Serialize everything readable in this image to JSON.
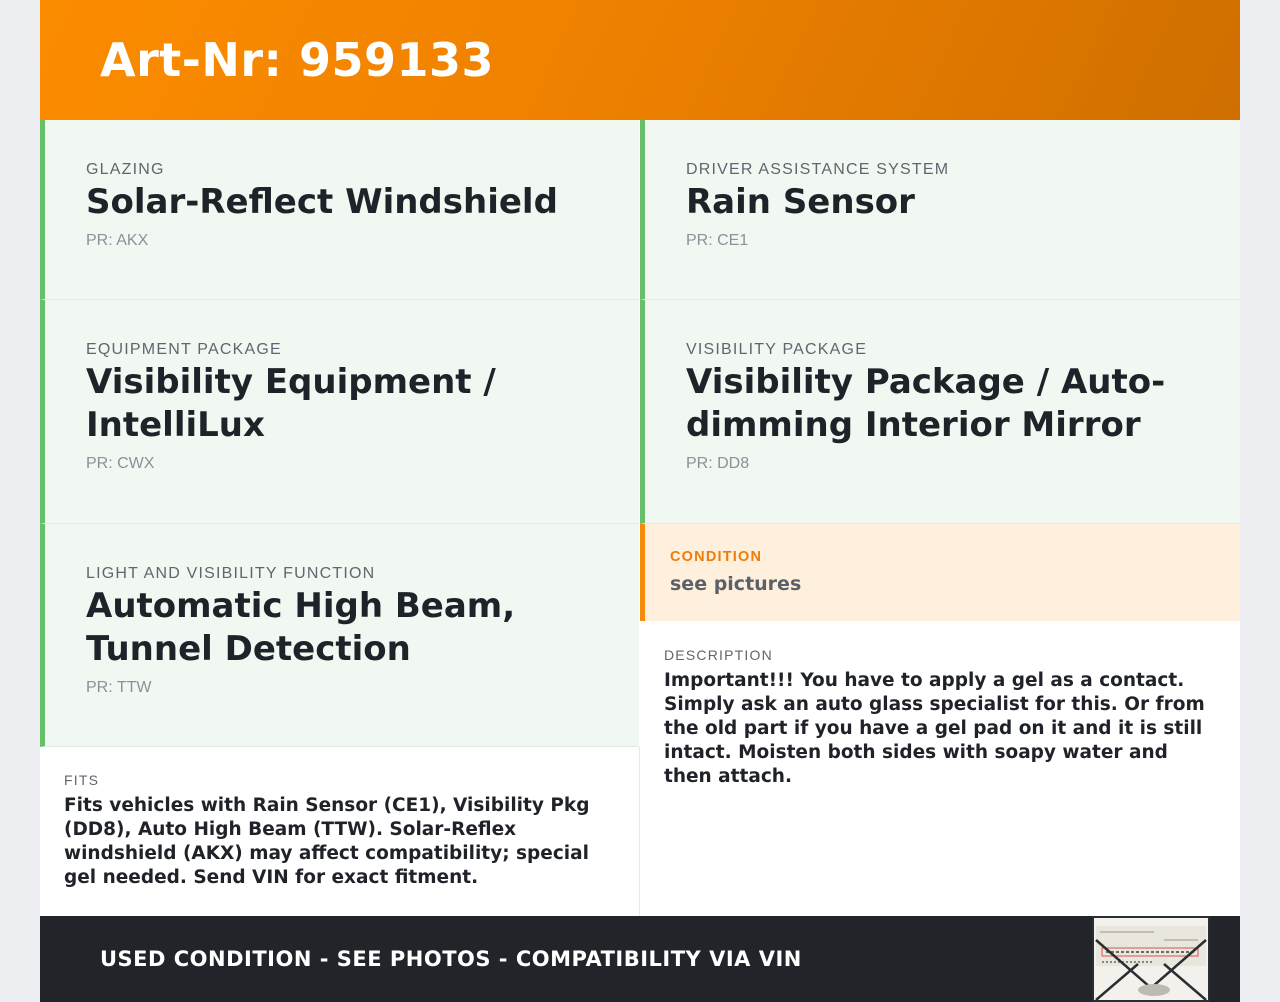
{
  "header": {
    "title": "Art-Nr: 959133"
  },
  "features": [
    {
      "category": "GLAZING",
      "name": "Solar-Reflect Windshield",
      "pr": "PR: AKX"
    },
    {
      "category": "DRIVER ASSISTANCE SYSTEM",
      "name": "Rain Sensor",
      "pr": "PR: CE1"
    },
    {
      "category": "EQUIPMENT PACKAGE",
      "name": "Visibility Equipment / IntelliLux",
      "pr": "PR: CWX"
    },
    {
      "category": "VISIBILITY PACKAGE",
      "name": "Visibility Package / Auto-dimming Interior Mirror",
      "pr": "PR: DD8"
    },
    {
      "category": "LIGHT AND VISIBILITY FUNCTION",
      "name": "Automatic High Beam, Tunnel Detection",
      "pr": "PR: TTW"
    }
  ],
  "condition": {
    "label": "CONDITION",
    "value": "see pictures"
  },
  "description": {
    "label": "DESCRIPTION",
    "text": "Important!!! You have to apply a gel as a contact. Simply ask an auto glass specialist for this. Or from the old part if you have a gel pad on it and it is still intact. Moisten both sides with soapy water and then attach."
  },
  "fits": {
    "label": "FITS",
    "text": "Fits vehicles with Rain Sensor (CE1), Visibility Pkg (DD8), Auto High Beam (TTW). Solar-Reflex windshield (AKX) may affect compatibility; special gel needed. Send VIN for exact fitment."
  },
  "footer": {
    "text": "USED CONDITION - SEE PHOTOS - COMPATIBILITY VIA VIN"
  },
  "colors": {
    "header_orange": "#fb8c00",
    "feature_accent_green": "#67bf6c",
    "condition_accent_orange": "#f68b0c",
    "footer_dark": "#212529"
  }
}
